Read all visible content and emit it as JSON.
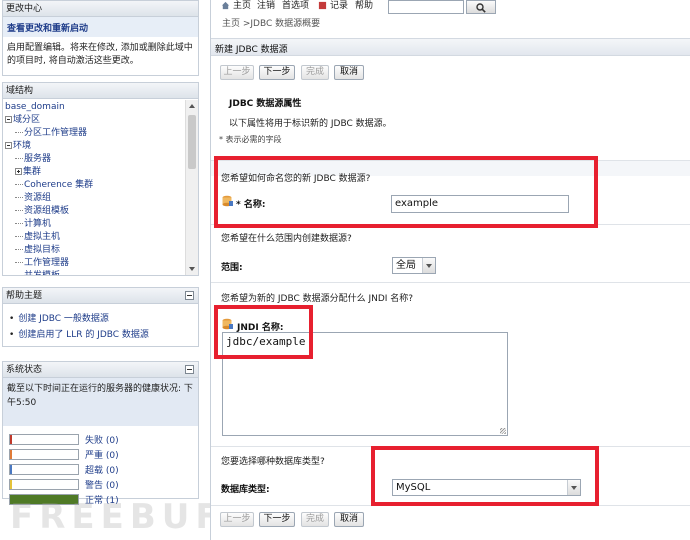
{
  "change_center": {
    "title": "更改中心",
    "view_link": "查看更改和重新启动",
    "description": "启用配置编辑。将来在修改, 添加或删除此域中的项目时, 将自动激活这些更改。"
  },
  "domain_structure": {
    "title": "域结构",
    "items": [
      {
        "label": "base_domain",
        "indent": 0,
        "kind": "none"
      },
      {
        "label": "域分区",
        "indent": 0,
        "kind": "minus"
      },
      {
        "label": "分区工作管理器",
        "indent": 1,
        "kind": "dash"
      },
      {
        "label": "环境",
        "indent": 0,
        "kind": "minus"
      },
      {
        "label": "服务器",
        "indent": 1,
        "kind": "dash"
      },
      {
        "label": "集群",
        "indent": 1,
        "kind": "plus"
      },
      {
        "label": "Coherence 集群",
        "indent": 1,
        "kind": "dash"
      },
      {
        "label": "资源组",
        "indent": 1,
        "kind": "dash"
      },
      {
        "label": "资源组模板",
        "indent": 1,
        "kind": "dash"
      },
      {
        "label": "计算机",
        "indent": 1,
        "kind": "dash"
      },
      {
        "label": "虚拟主机",
        "indent": 1,
        "kind": "dash"
      },
      {
        "label": "虚拟目标",
        "indent": 1,
        "kind": "dash"
      },
      {
        "label": "工作管理器",
        "indent": 1,
        "kind": "dash"
      },
      {
        "label": "并发模板",
        "indent": 1,
        "kind": "dash"
      }
    ]
  },
  "help_topics": {
    "title": "帮助主题",
    "items": [
      "创建 JDBC 一般数据源",
      "创建启用了 LLR 的 JDBC 数据源"
    ]
  },
  "system_status": {
    "title": "系统状态",
    "summary": "截至以下时间正在运行的服务器的健康状况: 下午5:50",
    "rows": [
      {
        "label": "失败 (0)",
        "color": "#c0392b",
        "fraction": 0
      },
      {
        "label": "严重 (0)",
        "color": "#e07b39",
        "fraction": 0
      },
      {
        "label": "超载 (0)",
        "color": "#4a78c2",
        "fraction": 0
      },
      {
        "label": "警告 (0)",
        "color": "#e5c33a",
        "fraction": 0
      },
      {
        "label": "正常 (1)",
        "color": "#4f7a26",
        "fraction": 1
      }
    ]
  },
  "topnav": {
    "home": "主页",
    "logout": "注销",
    "preferences": "首选项",
    "record": "记录",
    "help": "帮助",
    "search_value": ""
  },
  "breadcrumb": "主页 >JDBC 数据源概要",
  "page_title": "新建 JDBC 数据源",
  "buttons": {
    "back": "上一步",
    "next": "下一步",
    "finish": "完成",
    "cancel": "取消"
  },
  "properties": {
    "title": "JDBC 数据源属性",
    "description": "以下属性将用于标识新的 JDBC 数据源。",
    "required_note": "* 表示必需的字段"
  },
  "name_section": {
    "question": "您希望如何命名您的新 JDBC 数据源?",
    "label": "* 名称:",
    "value": "example"
  },
  "scope_section": {
    "question": "您希望在什么范围内创建数据源?",
    "label": "范围:",
    "value": "全局"
  },
  "jndi_section": {
    "question": "您希望为新的 JDBC 数据源分配什么 JNDI 名称?",
    "label": "JNDI 名称:",
    "value": "jdbc/example"
  },
  "dbtype_section": {
    "question": "您要选择哪种数据库类型?",
    "label": "数据库类型:",
    "value": "MySQL"
  },
  "watermark": "FREEBUF",
  "colors": {
    "highlight_box": "#e7202f",
    "link": "#1f3d8a"
  }
}
